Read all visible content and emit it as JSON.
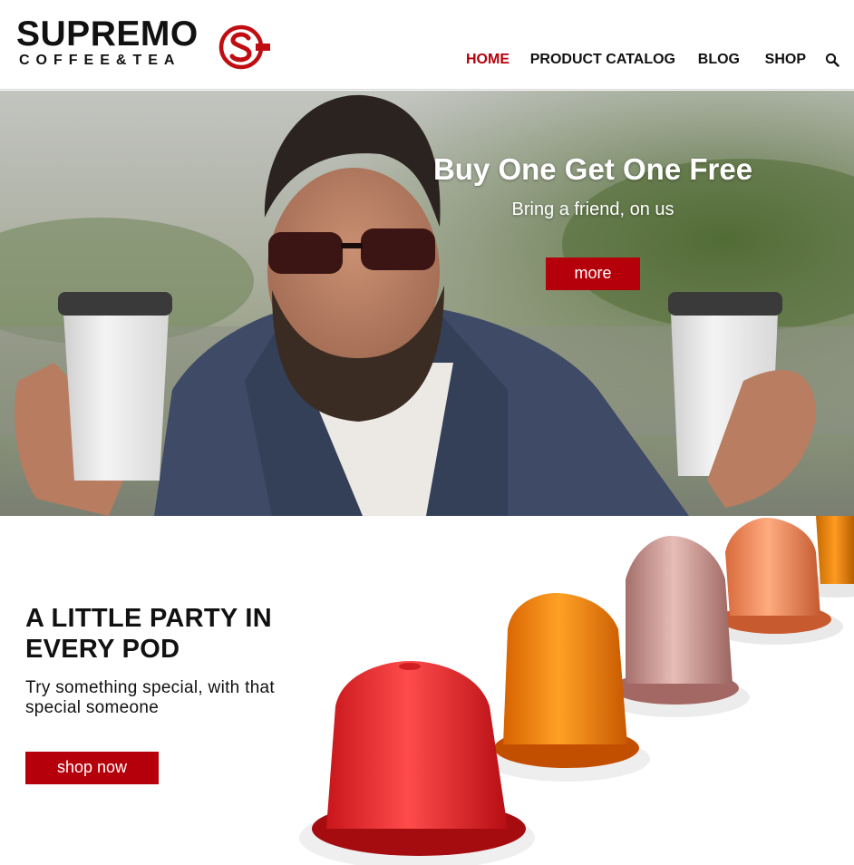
{
  "brand": {
    "name": "SUPREMO",
    "tagline": "COFFEE&TEA",
    "logo_mark_letter": "S",
    "accent_color": "#b5000b"
  },
  "nav": {
    "items": [
      {
        "label": "HOME",
        "active": true
      },
      {
        "label": "PRODUCT CATALOG",
        "active": false
      },
      {
        "label": "BLOG",
        "active": false
      },
      {
        "label": "SHOP",
        "active": false
      }
    ],
    "search_icon": "search-icon"
  },
  "hero": {
    "title": "Buy One Get One Free",
    "subtitle": "Bring a friend, on us",
    "button_label": "more"
  },
  "promo": {
    "title": "A LITTLE PARTY IN EVERY POD",
    "text": "Try something special, with that special someone",
    "button_label": "shop now"
  }
}
